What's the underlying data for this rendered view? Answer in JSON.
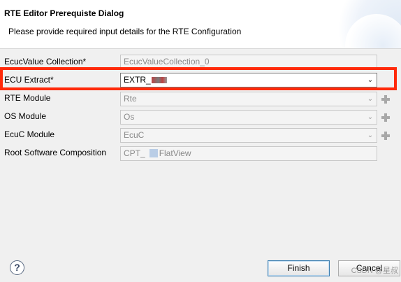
{
  "header": {
    "title": "RTE Editor Prerequiste Dialog",
    "description": "Please provide required input details for the RTE Configuration"
  },
  "form": {
    "ecuc_value_collection": {
      "label": "EcucValue Collection*",
      "value": "EcucValueCollection_0"
    },
    "ecu_extract": {
      "label": "ECU Extract*",
      "value": "EXTR_"
    },
    "rte_module": {
      "label": "RTE Module",
      "value": "Rte"
    },
    "os_module": {
      "label": "OS Module",
      "value": "Os"
    },
    "ecuc_module": {
      "label": "EcuC Module",
      "value": "EcuC"
    },
    "root_sw_composition": {
      "label": "Root Software Composition",
      "value_prefix": "CPT_",
      "value_suffix": "FlatView"
    }
  },
  "buttons": {
    "finish": "Finish",
    "cancel": "Cancel"
  },
  "help": {
    "icon_glyph": "?"
  },
  "combo_arrow": "⌄",
  "watermark": "CSDN @星叔",
  "icons": [
    "help-icon",
    "chevron-down-icon",
    "plus-icon"
  ],
  "colors": {
    "highlight": "#ff2a0a",
    "banner_bg": "#ffffff",
    "dialog_bg": "#f0f0f0"
  }
}
